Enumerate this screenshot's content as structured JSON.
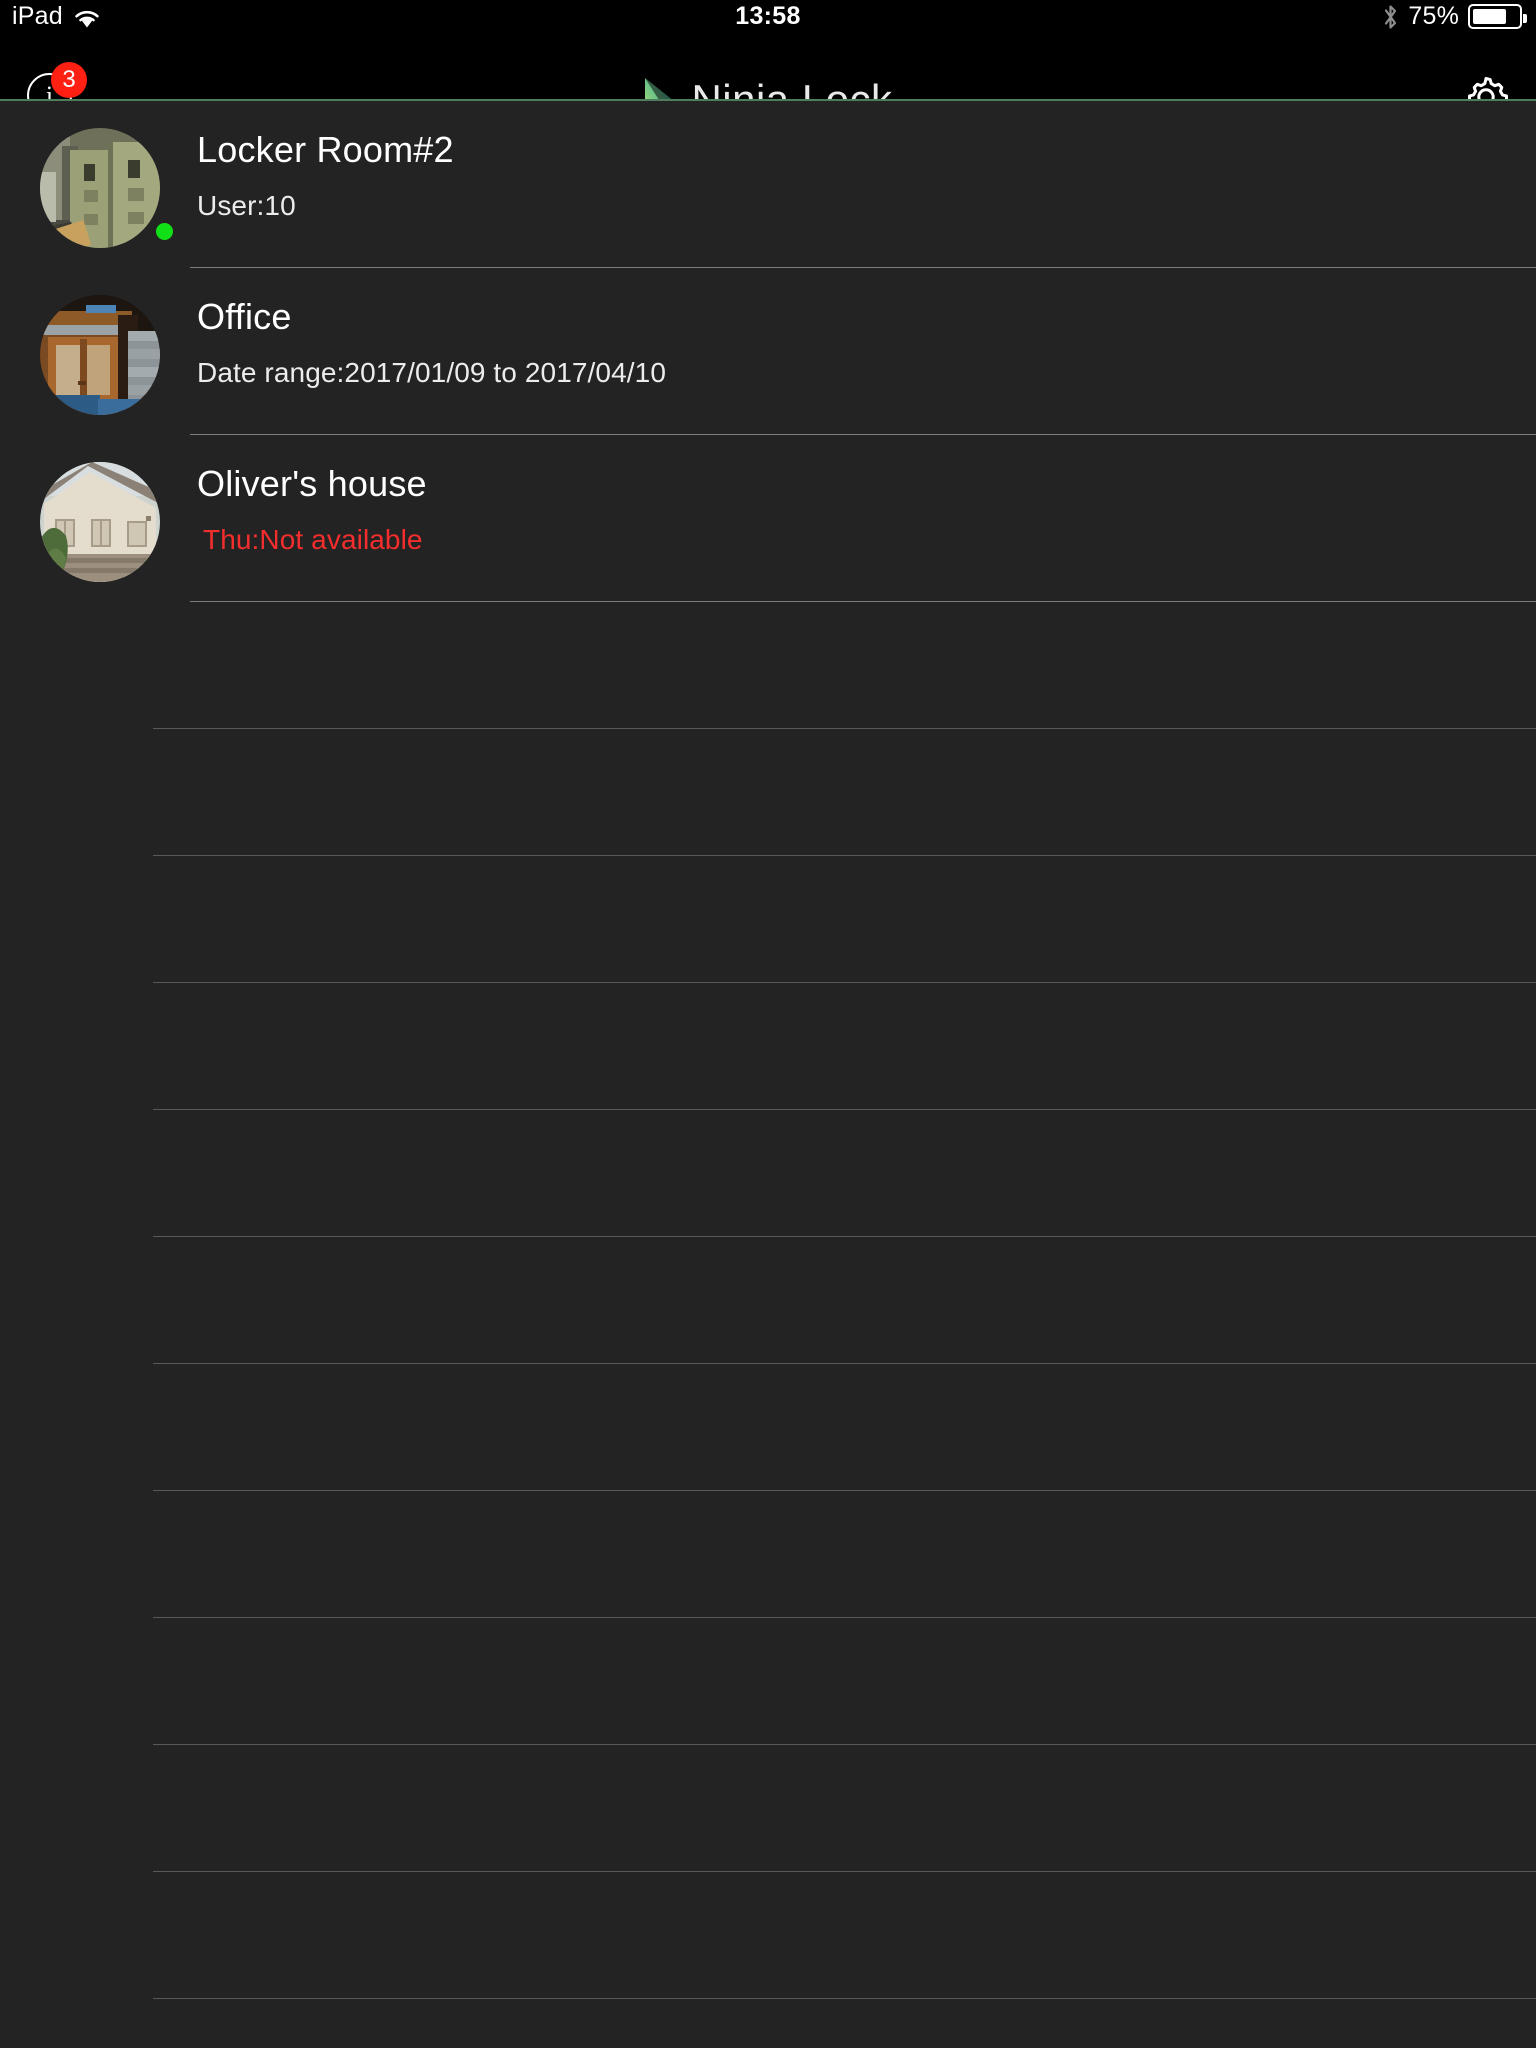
{
  "statusbar": {
    "device_label": "iPad",
    "wifi_icon": "wifi-icon",
    "time": "13:58",
    "bluetooth_icon": "bluetooth-icon",
    "battery_percent_label": "75%",
    "battery_level": 75
  },
  "navbar": {
    "info_button": {
      "icon": "info-icon",
      "glyph": "i",
      "badge_count": "3",
      "badge_color": "#fe2013"
    },
    "brand": {
      "logo_icon": "ninja-lock-logo-icon",
      "title": "Ninja Lock",
      "logo_gradient_from": "#c6e06a",
      "logo_gradient_to": "#1f9fa8"
    },
    "settings_button": {
      "icon": "gear-icon"
    },
    "hairline_color": "#4e7d5e"
  },
  "locks": [
    {
      "name": "Locker Room#2",
      "detail": "User:10",
      "detail_state": "normal",
      "thumbnail": "locker-room-photo",
      "online": true,
      "status_dot_color": "#12e016"
    },
    {
      "name": "Office",
      "detail": "Date range:2017/01/09 to 2017/04/10",
      "detail_state": "normal",
      "thumbnail": "office-door-photo",
      "online": false
    },
    {
      "name": "Oliver's house",
      "detail": "Thu:Not available",
      "detail_state": "unavailable",
      "thumbnail": "house-photo",
      "online": false,
      "detail_color": "#f42d2d"
    }
  ],
  "empty_rows": 11,
  "theme": {
    "background": "#232323",
    "navbar_background": "#000000",
    "separator": "#7c7c7c",
    "empty_separator": "#585858",
    "text_primary": "#ffffff"
  }
}
